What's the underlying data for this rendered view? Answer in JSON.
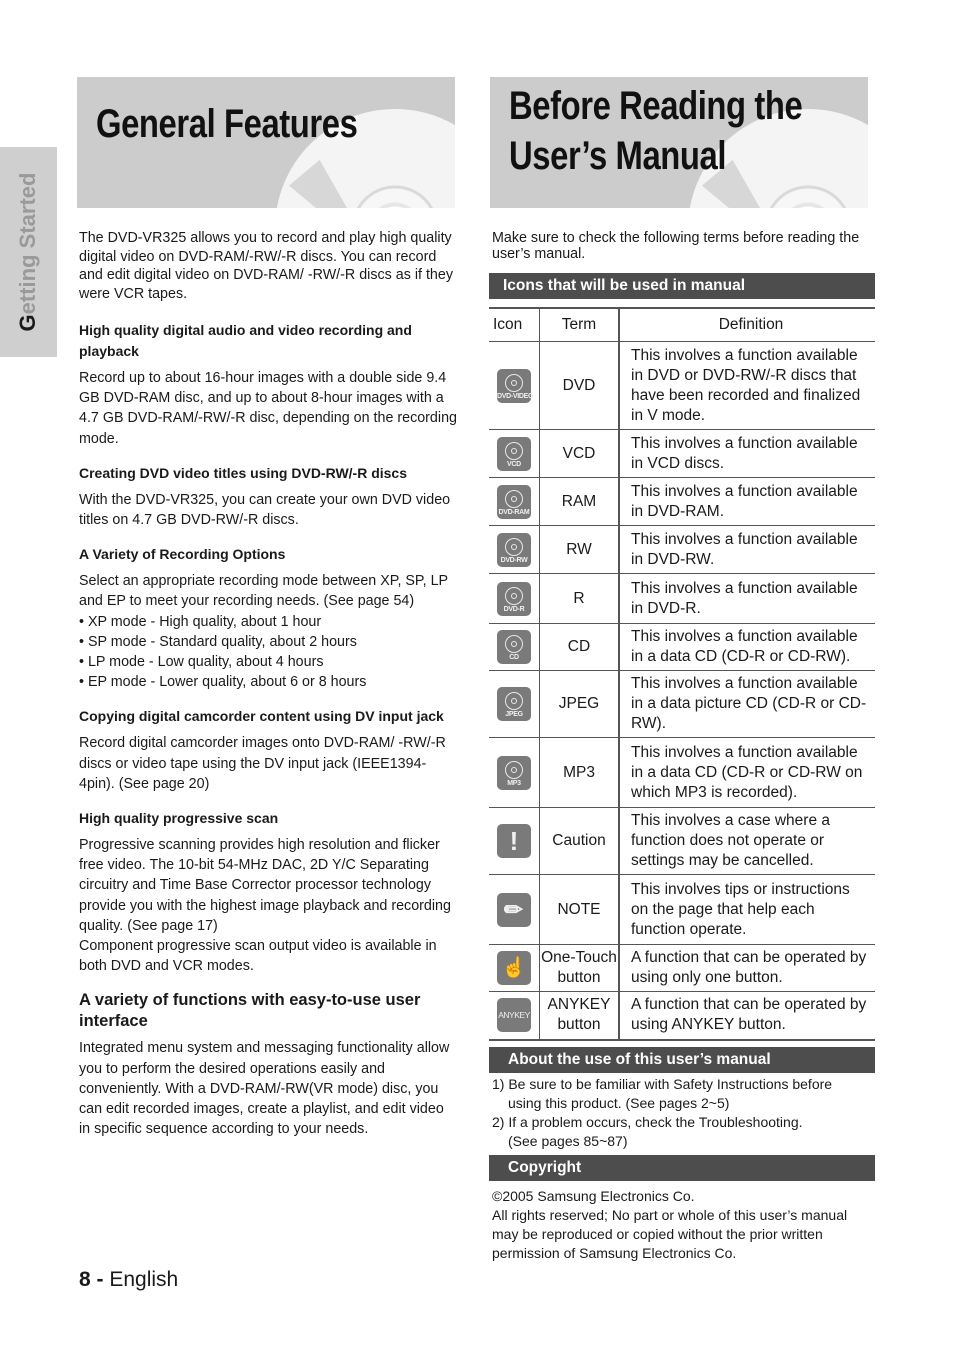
{
  "side_tab": {
    "first_letter": "G",
    "rest": "etting Started"
  },
  "left": {
    "title": "General Features",
    "intro": "The DVD-VR325 allows you to record and play high quality digital video on DVD-RAM/-RW/-R discs. You can record and edit digital video on DVD-RAM/ -RW/-R discs as if they were VCR tapes.",
    "features": [
      {
        "heading": "High quality digital audio and video recording and playback",
        "body": [
          "Record up to about 16-hour images with a double side 9.4 GB DVD-RAM disc, and up to about 8-hour images with a 4.7 GB DVD-RAM/-RW/-R disc, depending on the recording mode."
        ]
      },
      {
        "heading": "Creating DVD video titles using DVD-RW/-R discs",
        "body": [
          "With the DVD-VR325, you can  create your own DVD video titles on 4.7 GB DVD-RW/-R discs."
        ]
      },
      {
        "heading": "A Variety of Recording Options",
        "body": [
          "Select an appropriate recording mode between XP, SP, LP and EP to meet your recording needs. (See page 54)"
        ],
        "bullets": [
          "• XP mode - High quality, about 1 hour",
          "• SP mode - Standard quality, about 2 hours",
          "• LP mode - Low quality, about 4 hours",
          "• EP mode - Lower quality, about 6 or 8 hours"
        ]
      },
      {
        "heading": "Copying digital camcorder content using DV input jack",
        "body": [
          "Record digital camcorder images onto DVD-RAM/ -RW/-R discs or video tape using the DV input jack (IEEE1394-4pin). (See page 20)"
        ]
      },
      {
        "heading": "High quality progressive scan",
        "body": [
          "Progressive scanning provides high resolution and flicker free video. The 10-bit 54-MHz DAC, 2D Y/C Separating circuitry and Time Base Corrector processor technology provide you with the highest image playback and recording quality. (See page 17)",
          "Component progressive scan output video is available in both DVD and VCR modes."
        ]
      },
      {
        "heading": "A variety of functions with easy-to-use user interface",
        "body": [
          "Integrated menu system and messaging functionality allow you to perform the desired operations easily and conveniently. With a DVD-RAM/-RW(VR mode) disc, you can edit recorded images, create a playlist, and edit video in specific sequence according to your needs."
        ]
      }
    ]
  },
  "right": {
    "title_line1": "Before Reading the",
    "title_line2": "User’s Manual",
    "intro": "Make sure to check the following terms before reading the user’s manual.",
    "icons_section": {
      "title": "Icons that will be used in manual",
      "headers": {
        "icon": "Icon",
        "term": "Term",
        "definition": "Definition"
      },
      "rows": [
        {
          "icon": "dvd-video-disc-icon",
          "tile_label": "DVD-VIDEO",
          "term": "DVD",
          "definition": "This involves a function available in DVD or DVD-RW/-R discs that have been recorded and finalized in V mode."
        },
        {
          "icon": "vcd-disc-icon",
          "tile_label": "VCD",
          "term": "VCD",
          "definition": "This involves a function available in VCD discs."
        },
        {
          "icon": "dvd-ram-disc-icon",
          "tile_label": "DVD-RAM",
          "term": "RAM",
          "definition": "This involves a function available in DVD-RAM."
        },
        {
          "icon": "dvd-rw-disc-icon",
          "tile_label": "DVD-RW",
          "term": "RW",
          "definition": "This involves a function available in DVD-RW."
        },
        {
          "icon": "dvd-r-disc-icon",
          "tile_label": "DVD-R",
          "term": "R",
          "definition": "This involves a function available in DVD-R."
        },
        {
          "icon": "cd-disc-icon",
          "tile_label": "CD",
          "term": "CD",
          "definition": "This involves a function available in a data CD (CD-R or CD-RW)."
        },
        {
          "icon": "jpeg-disc-icon",
          "tile_label": "JPEG",
          "term": "JPEG",
          "definition": "This involves a function available in a data picture CD (CD-R or CD-RW)."
        },
        {
          "icon": "mp3-disc-icon",
          "tile_label": "MP3",
          "term": "MP3",
          "definition": "This involves a function available in a data CD (CD-R or CD-RW on which MP3 is recorded)."
        },
        {
          "icon": "caution-icon",
          "glyph": "!",
          "term": "Caution",
          "definition": "This involves a case where a function does not operate or settings may be cancelled."
        },
        {
          "icon": "note-pencil-icon",
          "glyph": "✎",
          "term": "NOTE",
          "definition": "This involves tips or instructions on the page that help each function operate."
        },
        {
          "icon": "one-touch-hand-icon",
          "glyph": "☝",
          "term": "One-Touch button",
          "definition": "A function that can be operated by using only one button."
        },
        {
          "icon": "anykey-icon",
          "glyph": "ANYKEY",
          "term": "ANYKEY button",
          "definition": "A function that can be operated by using ANYKEY button."
        }
      ]
    },
    "about_section": {
      "title": "About the use of this user’s manual",
      "items": [
        {
          "line1": "1) Be sure to be familiar with Safety Instructions before",
          "line2": "using this product. (See pages 2~5)"
        },
        {
          "line1": "2) If a problem occurs, check the Troubleshooting.",
          "line2": "(See pages 85~87)"
        }
      ]
    },
    "copyright_section": {
      "title": "Copyright",
      "line1": "©2005 Samsung Electronics Co.",
      "line2": "All rights reserved; No part or whole of this user’s manual may be reproduced or copied without the prior written permission of Samsung Electronics Co."
    }
  },
  "footer": {
    "page_number": "8 -",
    "language": "English"
  }
}
